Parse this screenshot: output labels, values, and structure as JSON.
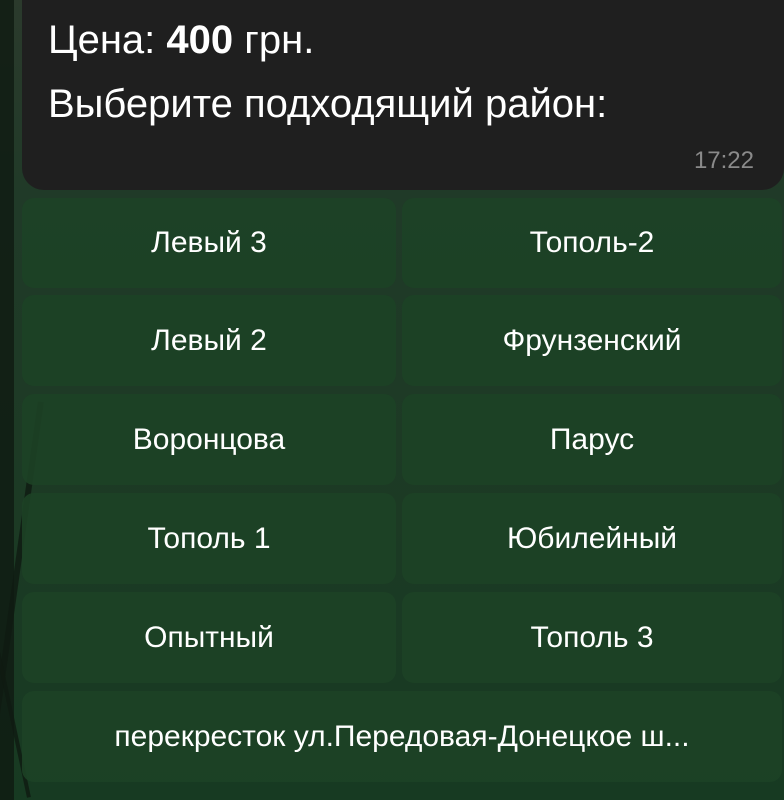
{
  "message": {
    "price_label": "Цена:",
    "price_value": "400",
    "price_currency": "грн.",
    "prompt": "Выберите подходящий район:",
    "time": "17:22"
  },
  "keyboard": {
    "rows": [
      [
        "Левый 3",
        "Тополь-2"
      ],
      [
        "Левый 2",
        "Фрунзенский"
      ],
      [
        "Воронцова",
        "Парус"
      ],
      [
        "Тополь 1",
        "Юбилейный"
      ],
      [
        "Опытный",
        "Тополь 3"
      ]
    ],
    "last": "перекресток ул.Передовая-Донецкое ш..."
  },
  "colors": {
    "bubble": "#1f1f1f",
    "button": "#1d4226",
    "text": "#ffffff",
    "time": "#8a8a8a"
  }
}
